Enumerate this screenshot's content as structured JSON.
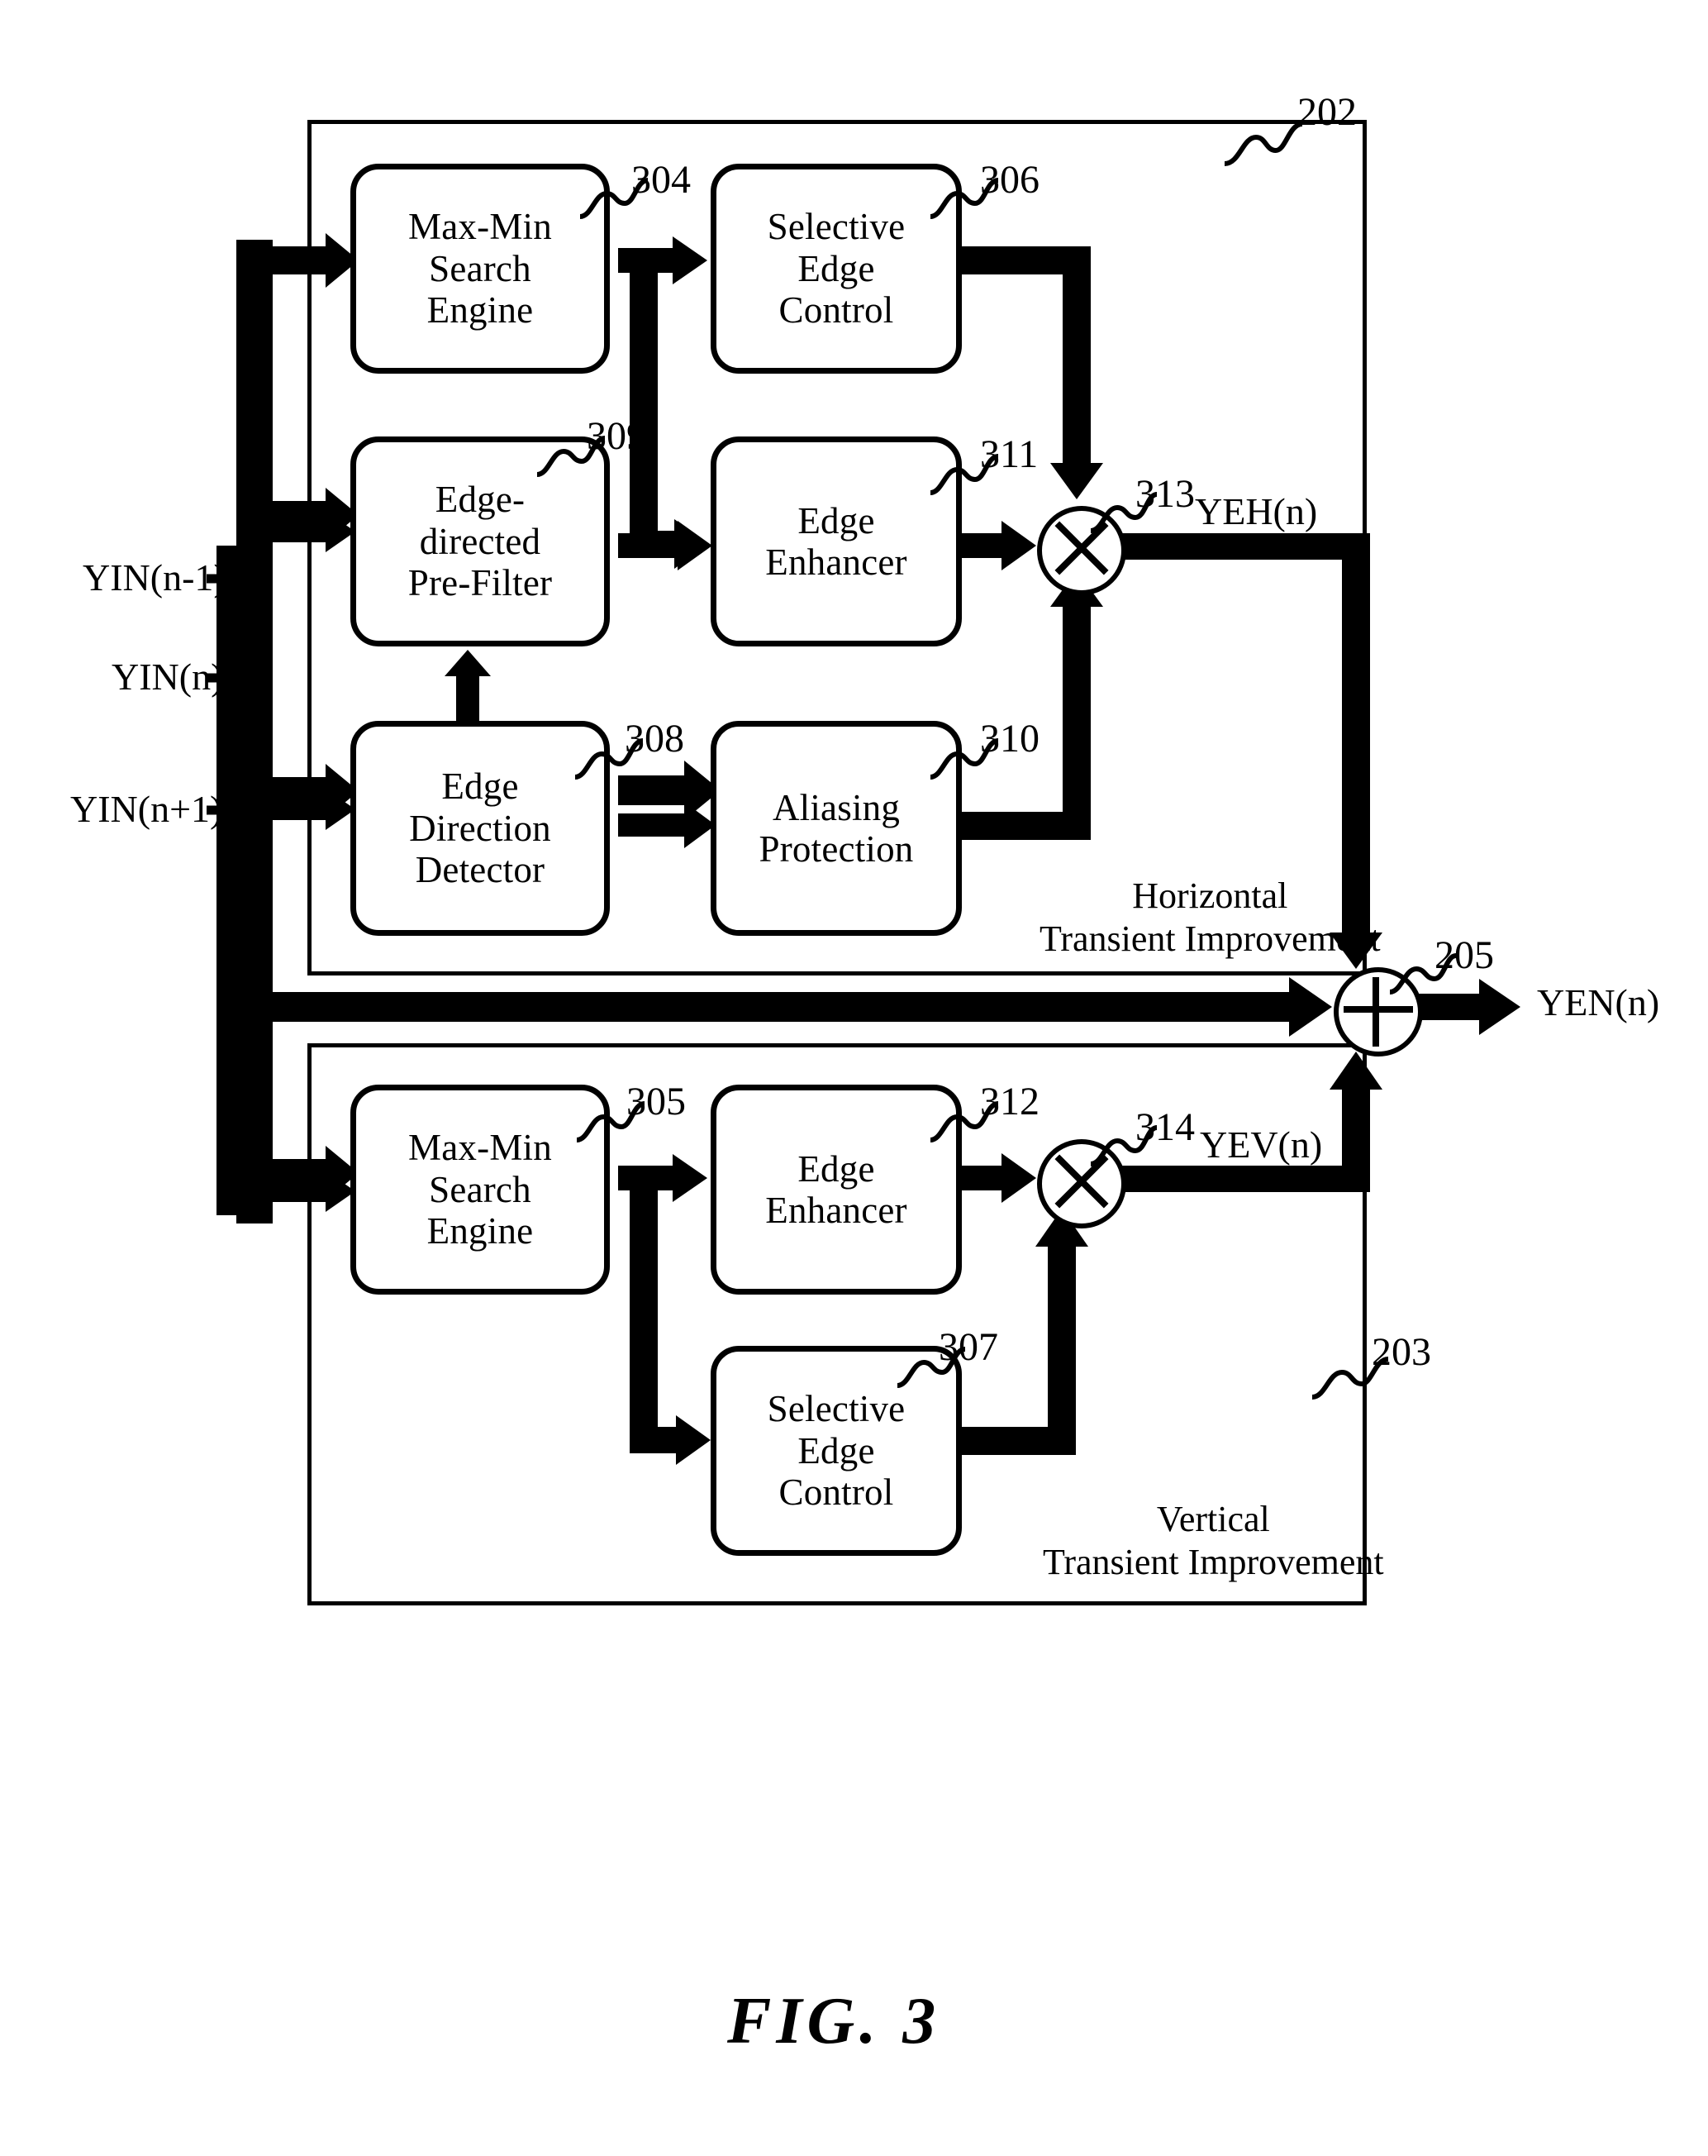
{
  "figure": {
    "caption": "FIG.  3",
    "inputs": [
      {
        "label": "YIN(n-1)"
      },
      {
        "label": "YIN(n)"
      },
      {
        "label": "YIN(n+1)"
      }
    ],
    "outputs": [
      {
        "label": "YEH(n)"
      },
      {
        "label": "YEV(n)"
      },
      {
        "label": "YEN(n)"
      }
    ],
    "groups": [
      {
        "id": "202",
        "ref": "202",
        "title_line1": "Horizontal",
        "title_line2": "Transient Improvement"
      },
      {
        "id": "203",
        "ref": "203",
        "title_line1": "Vertical",
        "title_line2": "Transient Improvement"
      }
    ],
    "blocks": [
      {
        "ref": "304",
        "line1": "Max-Min",
        "line2": "Search",
        "line3": "Engine"
      },
      {
        "ref": "306",
        "line1": "Selective",
        "line2": "Edge",
        "line3": "Control"
      },
      {
        "ref": "309",
        "line1": "Edge-",
        "line2": "directed",
        "line3": "Pre-Filter"
      },
      {
        "ref": "311",
        "line1": "Edge",
        "line2": "Enhancer",
        "line3": ""
      },
      {
        "ref": "308",
        "line1": "Edge",
        "line2": "Direction",
        "line3": "Detector"
      },
      {
        "ref": "310",
        "line1": "Aliasing",
        "line2": "Protection",
        "line3": ""
      },
      {
        "ref": "305",
        "line1": "Max-Min",
        "line2": "Search",
        "line3": "Engine"
      },
      {
        "ref": "312",
        "line1": "Edge",
        "line2": "Enhancer",
        "line3": ""
      },
      {
        "ref": "307",
        "line1": "Selective",
        "line2": "Edge",
        "line3": "Control"
      }
    ],
    "operators": [
      {
        "ref": "313",
        "kind": "multiplier-icon"
      },
      {
        "ref": "314",
        "kind": "multiplier-icon"
      },
      {
        "ref": "205",
        "kind": "adder-icon"
      }
    ],
    "colors": {
      "ink": "#000000",
      "paper": "#ffffff"
    }
  }
}
